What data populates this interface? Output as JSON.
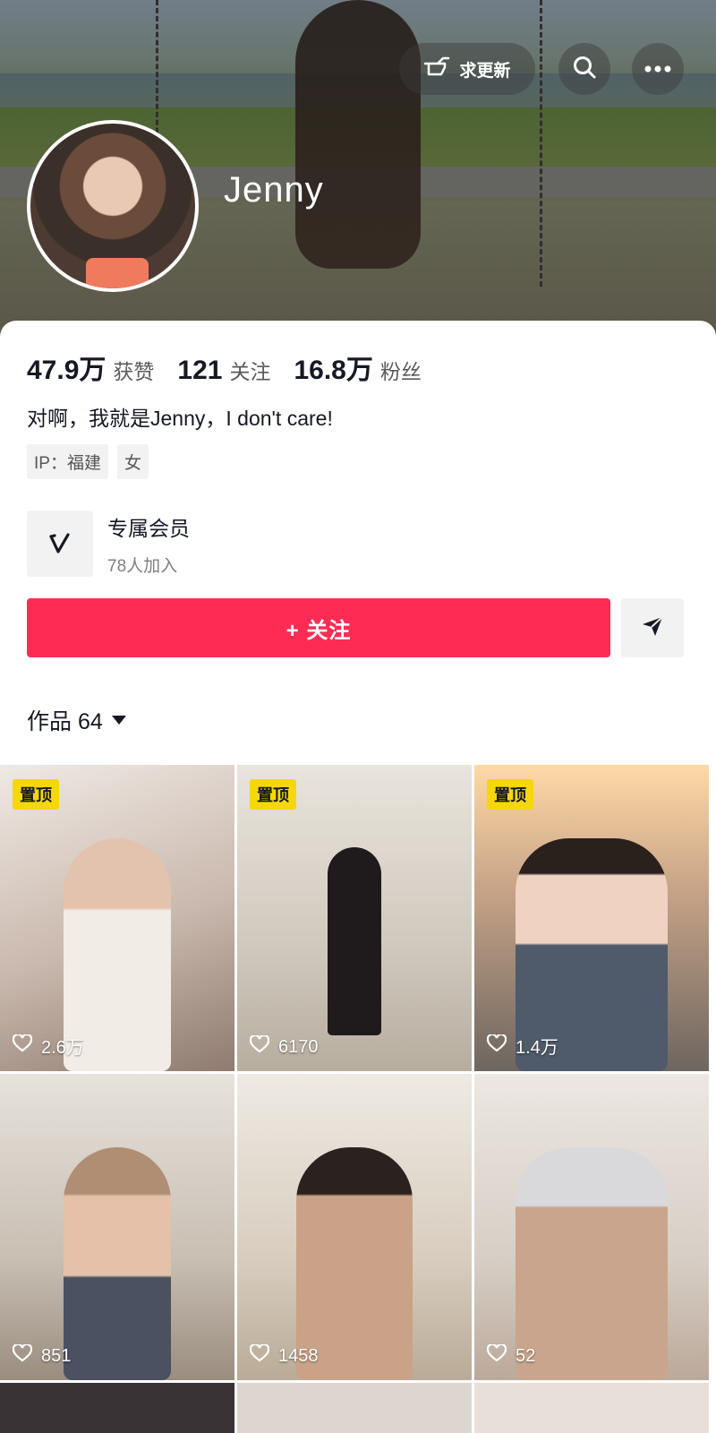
{
  "header": {
    "more_updates_label": "求更新",
    "username": "Jenny"
  },
  "stats": [
    {
      "value": "47.9万",
      "label": "获赞"
    },
    {
      "value": "121",
      "label": "关注"
    },
    {
      "value": "16.8万",
      "label": "粉丝"
    }
  ],
  "bio": "对啊，我就是Jenny，I don't care!",
  "tags": [
    "IP：福建",
    "女"
  ],
  "membership": {
    "title": "专属会员",
    "subtitle": "78人加入"
  },
  "actions": {
    "follow_label": "+ 关注"
  },
  "works": {
    "label": "作品 64"
  },
  "videos": [
    {
      "pinned": true,
      "pin_label": "置顶",
      "likes": "2.6万"
    },
    {
      "pinned": true,
      "pin_label": "置顶",
      "likes": "6170"
    },
    {
      "pinned": true,
      "pin_label": "置顶",
      "likes": "1.4万"
    },
    {
      "pinned": false,
      "likes": "851"
    },
    {
      "pinned": false,
      "likes": "1458"
    },
    {
      "pinned": false,
      "likes": "52"
    }
  ],
  "icons": {
    "more_updates": "pointing-hand-icon",
    "search": "search-icon",
    "menu": "more-dots-icon",
    "member": "v-badge-icon",
    "share": "send-arrow-icon",
    "like": "heart-outline-icon"
  },
  "colors": {
    "follow_button": "#fe2c55",
    "pin_badge": "#f5d70a"
  }
}
